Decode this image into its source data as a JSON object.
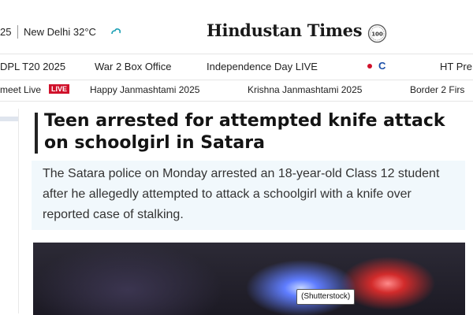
{
  "header": {
    "date_fragment": "25",
    "weather": "New Delhi 32°C",
    "brand": "Hindustan Times",
    "brand_badge": "100"
  },
  "nav_primary": [
    "DPL T20 2025",
    "War 2 Box Office",
    "Independence Day LIVE",
    "C",
    "HT Pre"
  ],
  "nav_secondary": {
    "first_item": "meet Live",
    "live_badge": "LIVE",
    "items": [
      "Happy Janmashtami 2025",
      "Krishna Janmashtami 2025",
      "Border 2 Firs"
    ]
  },
  "article": {
    "headline": "Teen arrested for attempted knife attack on schoolgirl in Satara",
    "summary": "The Satara police on Monday arrested an 18-year-old Class 12 student after he allegedly attempted to attack a schoolgirl with a knife over reported case of stalking.",
    "image_caption": "(Shutterstock)"
  },
  "colors": {
    "live_red": "#d0112b",
    "summary_bg": "#f1f8fc",
    "link_blue": "#1b4fa8"
  },
  "icons": [
    "weather-cloud-icon",
    "centenary-badge-icon"
  ]
}
